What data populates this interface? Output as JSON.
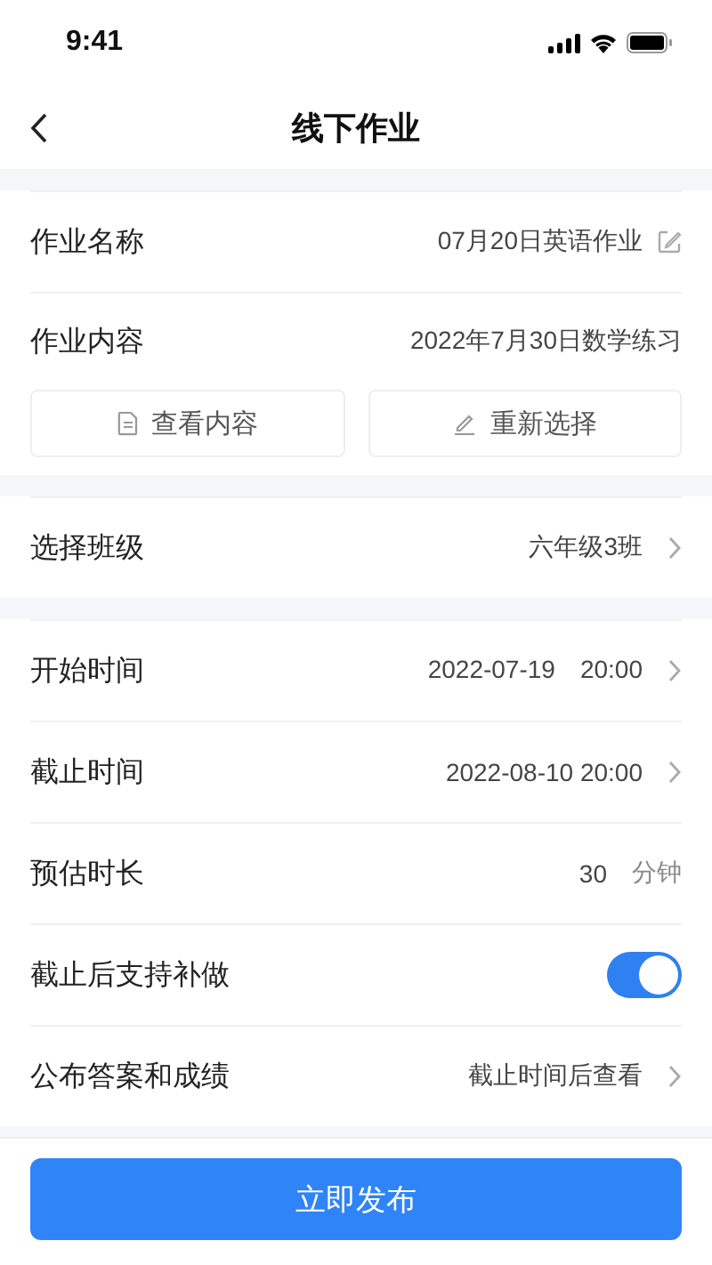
{
  "status_bar": {
    "time": "9:41"
  },
  "nav": {
    "title": "线下作业"
  },
  "sections": [
    {
      "rows": [
        {
          "kind": "edit",
          "label": "作业名称",
          "value": "07月20日英语作业"
        },
        {
          "kind": "content",
          "label": "作业内容",
          "value": "2022年7月30日数学练习",
          "actions": [
            {
              "kind": "document",
              "label": "查看内容"
            },
            {
              "kind": "pencil",
              "label": "重新选择"
            }
          ]
        }
      ]
    },
    {
      "rows": [
        {
          "kind": "link",
          "label": "选择班级",
          "value": "六年级3班"
        }
      ]
    },
    {
      "rows": [
        {
          "kind": "link",
          "label": "开始时间",
          "value": "2022-07-19　20:00"
        },
        {
          "kind": "link",
          "label": "截止时间",
          "value": "2022-08-10 20:00"
        },
        {
          "kind": "unit",
          "label": "预估时长",
          "value": "30",
          "unit": "分钟"
        },
        {
          "kind": "switch",
          "label": "截止后支持补做",
          "on": true
        },
        {
          "kind": "link",
          "label": "公布答案和成绩",
          "value": "截止时间后查看"
        }
      ]
    }
  ],
  "footer": {
    "button": "立即发布"
  }
}
